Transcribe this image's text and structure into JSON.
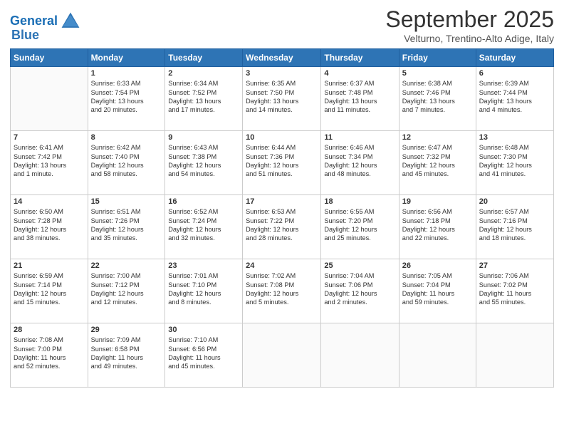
{
  "logo": {
    "line1": "General",
    "line2": "Blue"
  },
  "title": "September 2025",
  "subtitle": "Velturno, Trentino-Alto Adige, Italy",
  "days_of_week": [
    "Sunday",
    "Monday",
    "Tuesday",
    "Wednesday",
    "Thursday",
    "Friday",
    "Saturday"
  ],
  "weeks": [
    [
      {
        "day": "",
        "info": ""
      },
      {
        "day": "1",
        "info": "Sunrise: 6:33 AM\nSunset: 7:54 PM\nDaylight: 13 hours\nand 20 minutes."
      },
      {
        "day": "2",
        "info": "Sunrise: 6:34 AM\nSunset: 7:52 PM\nDaylight: 13 hours\nand 17 minutes."
      },
      {
        "day": "3",
        "info": "Sunrise: 6:35 AM\nSunset: 7:50 PM\nDaylight: 13 hours\nand 14 minutes."
      },
      {
        "day": "4",
        "info": "Sunrise: 6:37 AM\nSunset: 7:48 PM\nDaylight: 13 hours\nand 11 minutes."
      },
      {
        "day": "5",
        "info": "Sunrise: 6:38 AM\nSunset: 7:46 PM\nDaylight: 13 hours\nand 7 minutes."
      },
      {
        "day": "6",
        "info": "Sunrise: 6:39 AM\nSunset: 7:44 PM\nDaylight: 13 hours\nand 4 minutes."
      }
    ],
    [
      {
        "day": "7",
        "info": "Sunrise: 6:41 AM\nSunset: 7:42 PM\nDaylight: 13 hours\nand 1 minute."
      },
      {
        "day": "8",
        "info": "Sunrise: 6:42 AM\nSunset: 7:40 PM\nDaylight: 12 hours\nand 58 minutes."
      },
      {
        "day": "9",
        "info": "Sunrise: 6:43 AM\nSunset: 7:38 PM\nDaylight: 12 hours\nand 54 minutes."
      },
      {
        "day": "10",
        "info": "Sunrise: 6:44 AM\nSunset: 7:36 PM\nDaylight: 12 hours\nand 51 minutes."
      },
      {
        "day": "11",
        "info": "Sunrise: 6:46 AM\nSunset: 7:34 PM\nDaylight: 12 hours\nand 48 minutes."
      },
      {
        "day": "12",
        "info": "Sunrise: 6:47 AM\nSunset: 7:32 PM\nDaylight: 12 hours\nand 45 minutes."
      },
      {
        "day": "13",
        "info": "Sunrise: 6:48 AM\nSunset: 7:30 PM\nDaylight: 12 hours\nand 41 minutes."
      }
    ],
    [
      {
        "day": "14",
        "info": "Sunrise: 6:50 AM\nSunset: 7:28 PM\nDaylight: 12 hours\nand 38 minutes."
      },
      {
        "day": "15",
        "info": "Sunrise: 6:51 AM\nSunset: 7:26 PM\nDaylight: 12 hours\nand 35 minutes."
      },
      {
        "day": "16",
        "info": "Sunrise: 6:52 AM\nSunset: 7:24 PM\nDaylight: 12 hours\nand 32 minutes."
      },
      {
        "day": "17",
        "info": "Sunrise: 6:53 AM\nSunset: 7:22 PM\nDaylight: 12 hours\nand 28 minutes."
      },
      {
        "day": "18",
        "info": "Sunrise: 6:55 AM\nSunset: 7:20 PM\nDaylight: 12 hours\nand 25 minutes."
      },
      {
        "day": "19",
        "info": "Sunrise: 6:56 AM\nSunset: 7:18 PM\nDaylight: 12 hours\nand 22 minutes."
      },
      {
        "day": "20",
        "info": "Sunrise: 6:57 AM\nSunset: 7:16 PM\nDaylight: 12 hours\nand 18 minutes."
      }
    ],
    [
      {
        "day": "21",
        "info": "Sunrise: 6:59 AM\nSunset: 7:14 PM\nDaylight: 12 hours\nand 15 minutes."
      },
      {
        "day": "22",
        "info": "Sunrise: 7:00 AM\nSunset: 7:12 PM\nDaylight: 12 hours\nand 12 minutes."
      },
      {
        "day": "23",
        "info": "Sunrise: 7:01 AM\nSunset: 7:10 PM\nDaylight: 12 hours\nand 8 minutes."
      },
      {
        "day": "24",
        "info": "Sunrise: 7:02 AM\nSunset: 7:08 PM\nDaylight: 12 hours\nand 5 minutes."
      },
      {
        "day": "25",
        "info": "Sunrise: 7:04 AM\nSunset: 7:06 PM\nDaylight: 12 hours\nand 2 minutes."
      },
      {
        "day": "26",
        "info": "Sunrise: 7:05 AM\nSunset: 7:04 PM\nDaylight: 11 hours\nand 59 minutes."
      },
      {
        "day": "27",
        "info": "Sunrise: 7:06 AM\nSunset: 7:02 PM\nDaylight: 11 hours\nand 55 minutes."
      }
    ],
    [
      {
        "day": "28",
        "info": "Sunrise: 7:08 AM\nSunset: 7:00 PM\nDaylight: 11 hours\nand 52 minutes."
      },
      {
        "day": "29",
        "info": "Sunrise: 7:09 AM\nSunset: 6:58 PM\nDaylight: 11 hours\nand 49 minutes."
      },
      {
        "day": "30",
        "info": "Sunrise: 7:10 AM\nSunset: 6:56 PM\nDaylight: 11 hours\nand 45 minutes."
      },
      {
        "day": "",
        "info": ""
      },
      {
        "day": "",
        "info": ""
      },
      {
        "day": "",
        "info": ""
      },
      {
        "day": "",
        "info": ""
      }
    ]
  ]
}
